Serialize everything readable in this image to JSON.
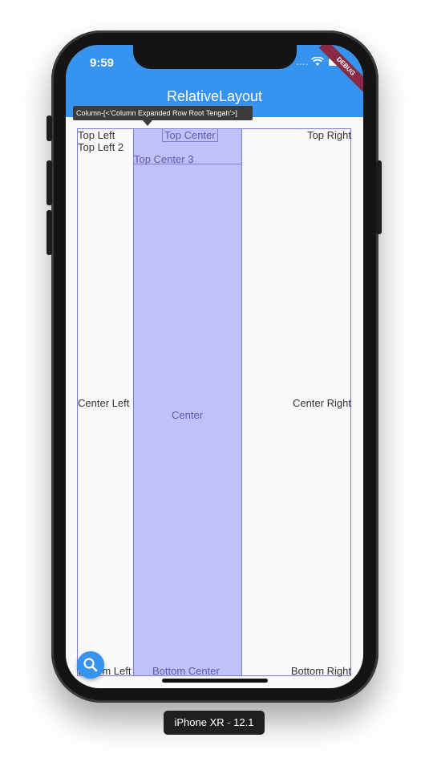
{
  "status_bar": {
    "time": "9:59",
    "signal_text": "....",
    "wifi_glyph": "wifi-icon",
    "battery_glyph": "battery-icon"
  },
  "app_bar": {
    "title": "RelativeLayout",
    "debug_banner": "DEBUG",
    "color": "#3694f0"
  },
  "inspector": {
    "tooltip": "Column-[<'Column Expanded Row Root Tengah'>]",
    "highlight_color": "#c1c1fa",
    "outline_color": "#7a7ed2"
  },
  "labels": {
    "top_left": "Top Left",
    "top_left_2": "Top Left 2",
    "top_center": "Top Center",
    "top_center_3": "Top Center 3",
    "top_right": "Top Right",
    "center_left": "Center Left",
    "center": "Center",
    "center_right": "Center Right",
    "bottom_left": "Bottom Left",
    "bottom_center": "Bottom Center",
    "bottom_right": "Bottom Right"
  },
  "fab": {
    "icon": "search-icon"
  },
  "device": {
    "name": "iPhone XR - 12.1"
  }
}
